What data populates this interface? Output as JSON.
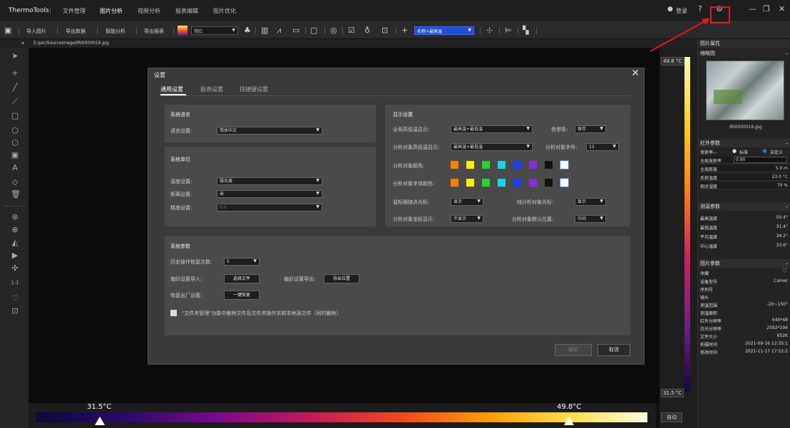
{
  "titlebar": {
    "app_name": "ThermoTools",
    "tabs": [
      "文件管理",
      "图片分析",
      "视频分析",
      "报表编辑",
      "图片优化"
    ],
    "login": "登录"
  },
  "toolbar": {
    "items": [
      "导入图片",
      "导出数据",
      "智能分析",
      "导出报表"
    ],
    "palette": "铁红",
    "name_select": "名称+最高温"
  },
  "path": "E:/pic/SourceImage/IRI0000016.jpg",
  "colorbar": {
    "min_label": "31.5°C",
    "max_label": "49.8°C"
  },
  "vscale": {
    "top": "49.8 °C",
    "bottom": "31.5 °C",
    "auto": "自动"
  },
  "right_panel": {
    "title": "图片属性",
    "thumb_title": "缩略图",
    "thumb_file": "IRI0000016.jpg",
    "ir_title": "红外参数",
    "emissivity_label": "发射率—",
    "radio_std": "标准",
    "radio_custom": "自定义",
    "ir_rows": [
      {
        "k": "全局发射率",
        "v": "0.90"
      },
      {
        "k": "全局距离",
        "v": "5.0 m"
      },
      {
        "k": "反射温度",
        "v": "23.0 °C"
      },
      {
        "k": "相对湿度",
        "v": "70 %"
      }
    ],
    "measure_title": "测温参数",
    "measure_rows": [
      {
        "k": "最高温度",
        "v": "50.4°"
      },
      {
        "k": "最低温度",
        "v": "31.4°"
      },
      {
        "k": "平均温度",
        "v": "34.2°"
      },
      {
        "k": "中心温度",
        "v": "33.6°"
      }
    ],
    "pic_title": "图片参数",
    "pic_rows": [
      {
        "k": "收藏",
        "v": "♡"
      },
      {
        "k": "设备型号",
        "v": "Camer"
      },
      {
        "k": "序列号",
        "v": ""
      },
      {
        "k": "镜头",
        "v": ""
      },
      {
        "k": "测温范围",
        "v": "-20~150°"
      },
      {
        "k": "测温面积",
        "v": ""
      },
      {
        "k": "红外分辨率",
        "v": "640*48"
      },
      {
        "k": "白光分辨率",
        "v": "2592*194"
      },
      {
        "k": "文件大小",
        "v": "652K"
      },
      {
        "k": "拍摄时间",
        "v": "2021-09-16 12:35:1"
      },
      {
        "k": "修改时间",
        "v": "2021-11-17 17:52:2"
      }
    ]
  },
  "dialog": {
    "title": "设置",
    "tabs": [
      "通用设置",
      "报表设置",
      "快捷键设置"
    ],
    "lang": {
      "title": "系统语言",
      "label": "语言设置:",
      "value": "简体中文"
    },
    "unit": {
      "title": "系统单位",
      "temp_label": "温度设置:",
      "temp_value": "摄氏度",
      "dist_label": "距离设置:",
      "dist_value": "米",
      "prec_label": "精度设置:",
      "prec_value": "0.0"
    },
    "display": {
      "title": "显示设置",
      "global_label": "全局高低温显示:",
      "global_value": "最高温+最低温",
      "colorbar_label": "色带条:",
      "colorbar_value": "保存",
      "obj_label": "分析对象高低温显示:",
      "obj_value": "最高温+最低温",
      "font_label": "分析对象字号:",
      "font_value": "12",
      "color_label": "分析对象颜色:",
      "fontcolor_label": "分析对象字体颜色:",
      "cursor_label": "鼠标跟随点光标:",
      "cursor_value": "显示",
      "line_label": "线分析对象光标:",
      "line_value": "显示",
      "coord_label": "分析对象坐标显示:",
      "coord_value": "不显示",
      "pos_label": "分析对象默认位置:",
      "pos_value": "中间",
      "colors": [
        "#ff7f00",
        "#ffee00",
        "#2ad42a",
        "#17d4e8",
        "#1a3cff",
        "#8a2be2",
        "#111111",
        "#ffffff"
      ]
    },
    "sys": {
      "title": "系统参数",
      "history_label": "历史操作恢复次数:",
      "history_value": "5",
      "import_label": "偏好设置导入:",
      "import_btn": "选择文件",
      "export_label": "偏好设置导出:",
      "export_btn": "导出位置",
      "reset_label": "恢复出厂设置:",
      "reset_btn": "一键恢复",
      "checkbox_text": "\"文件夹管理\"功能中删除文件及文件夹操作关联本地源文件（同时删除）"
    },
    "ok": "确定",
    "cancel": "取消"
  }
}
